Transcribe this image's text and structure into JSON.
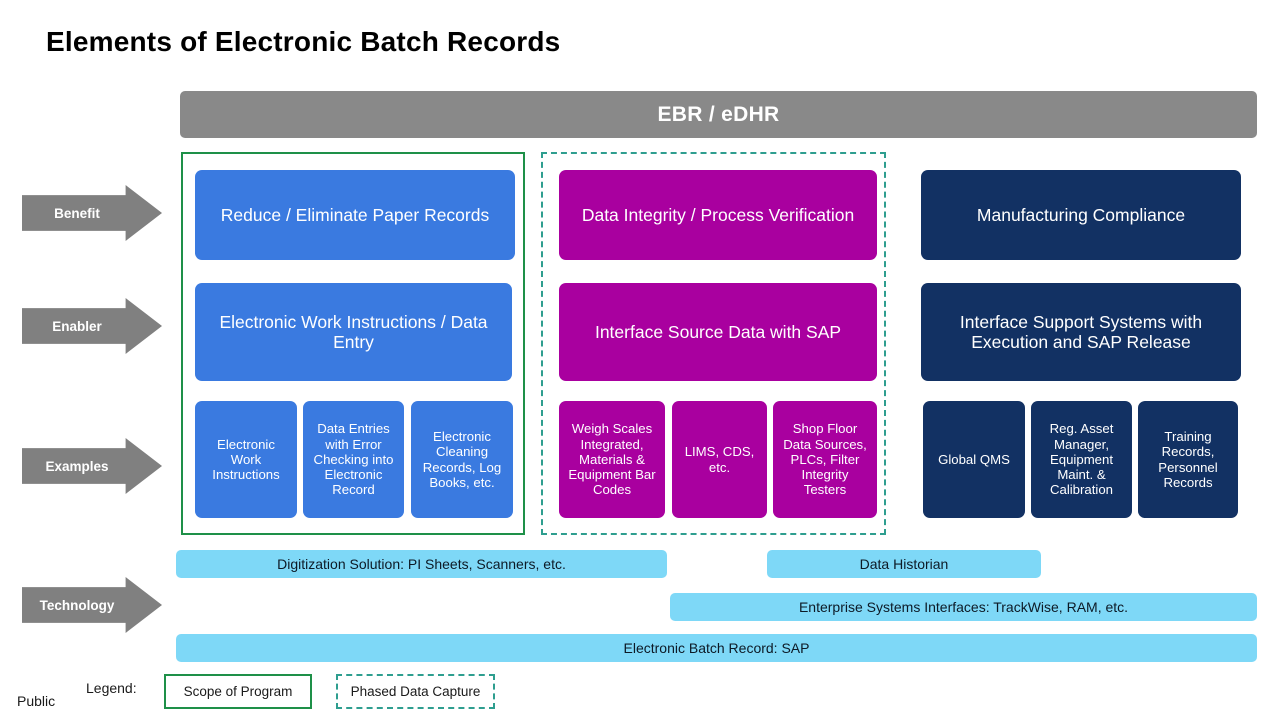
{
  "slide": {
    "title": "Elements of Electronic Batch Records",
    "classification": "Public"
  },
  "header": {
    "label": "EBR / eDHR",
    "color": "#898989"
  },
  "row_labels": [
    {
      "key": "benefit",
      "label": "Benefit"
    },
    {
      "key": "enabler",
      "label": "Enabler"
    },
    {
      "key": "examples",
      "label": "Examples"
    },
    {
      "key": "technology",
      "label": "Technology"
    }
  ],
  "columns": [
    {
      "key": "paper-records",
      "color": "#3a7ae0",
      "benefit": "Reduce / Eliminate  Paper Records",
      "enabler": "Electronic Work Instructions / Data Entry",
      "examples": [
        "Electronic Work Instructions",
        "Data Entries with Error Checking into Electronic Record",
        "Electronic Cleaning Records, Log Books, etc."
      ]
    },
    {
      "key": "data-integrity",
      "color": "#a9009f",
      "benefit": "Data Integrity / Process Verification",
      "enabler": "Interface Source Data with SAP",
      "examples": [
        "Weigh Scales Integrated, Materials & Equipment Bar Codes",
        "LIMS, CDS, etc.",
        "Shop Floor Data Sources, PLCs, Filter Integrity Testers"
      ]
    },
    {
      "key": "compliance",
      "color": "#123163",
      "benefit": "Manufacturing  Compliance",
      "enabler": "Interface Support  Systems with Execution and SAP Release",
      "examples": [
        "Global QMS",
        "Reg. Asset Manager, Equipment Maint. & Calibration",
        "Training Records, Personnel Records"
      ]
    }
  ],
  "technology_bars": [
    {
      "key": "digitization",
      "label": "Digitization  Solution:  PI Sheets,  Scanners,  etc."
    },
    {
      "key": "data-historian",
      "label": "Data Historian"
    },
    {
      "key": "enterprise",
      "label": "Enterprise  Systems  Interfaces:  TrackWise, RAM, etc."
    },
    {
      "key": "ebr-sap",
      "label": "Electronic  Batch  Record:  SAP"
    }
  ],
  "technology_color": "#7ed8f7",
  "legend": {
    "caption": "Legend:",
    "scope": {
      "label": "Scope of Program",
      "border_color": "#1e9048",
      "style": "solid"
    },
    "phased": {
      "label": "Phased Data Capture",
      "border_color": "#2e9e8f",
      "style": "dashed"
    }
  }
}
